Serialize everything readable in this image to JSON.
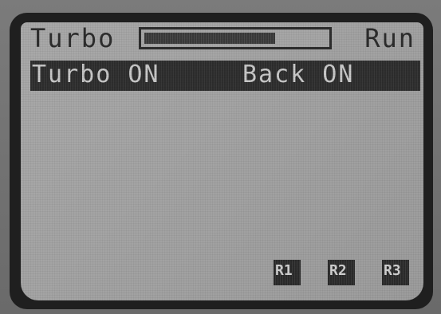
{
  "screen": {
    "mode_label": "Turbo",
    "state_label": "Run",
    "turbo_level": 0.72,
    "status_left": "Turbo ON",
    "status_right": "Back ON",
    "buttons": [
      {
        "label": "R1"
      },
      {
        "label": "R2"
      },
      {
        "label": "R3"
      }
    ]
  }
}
